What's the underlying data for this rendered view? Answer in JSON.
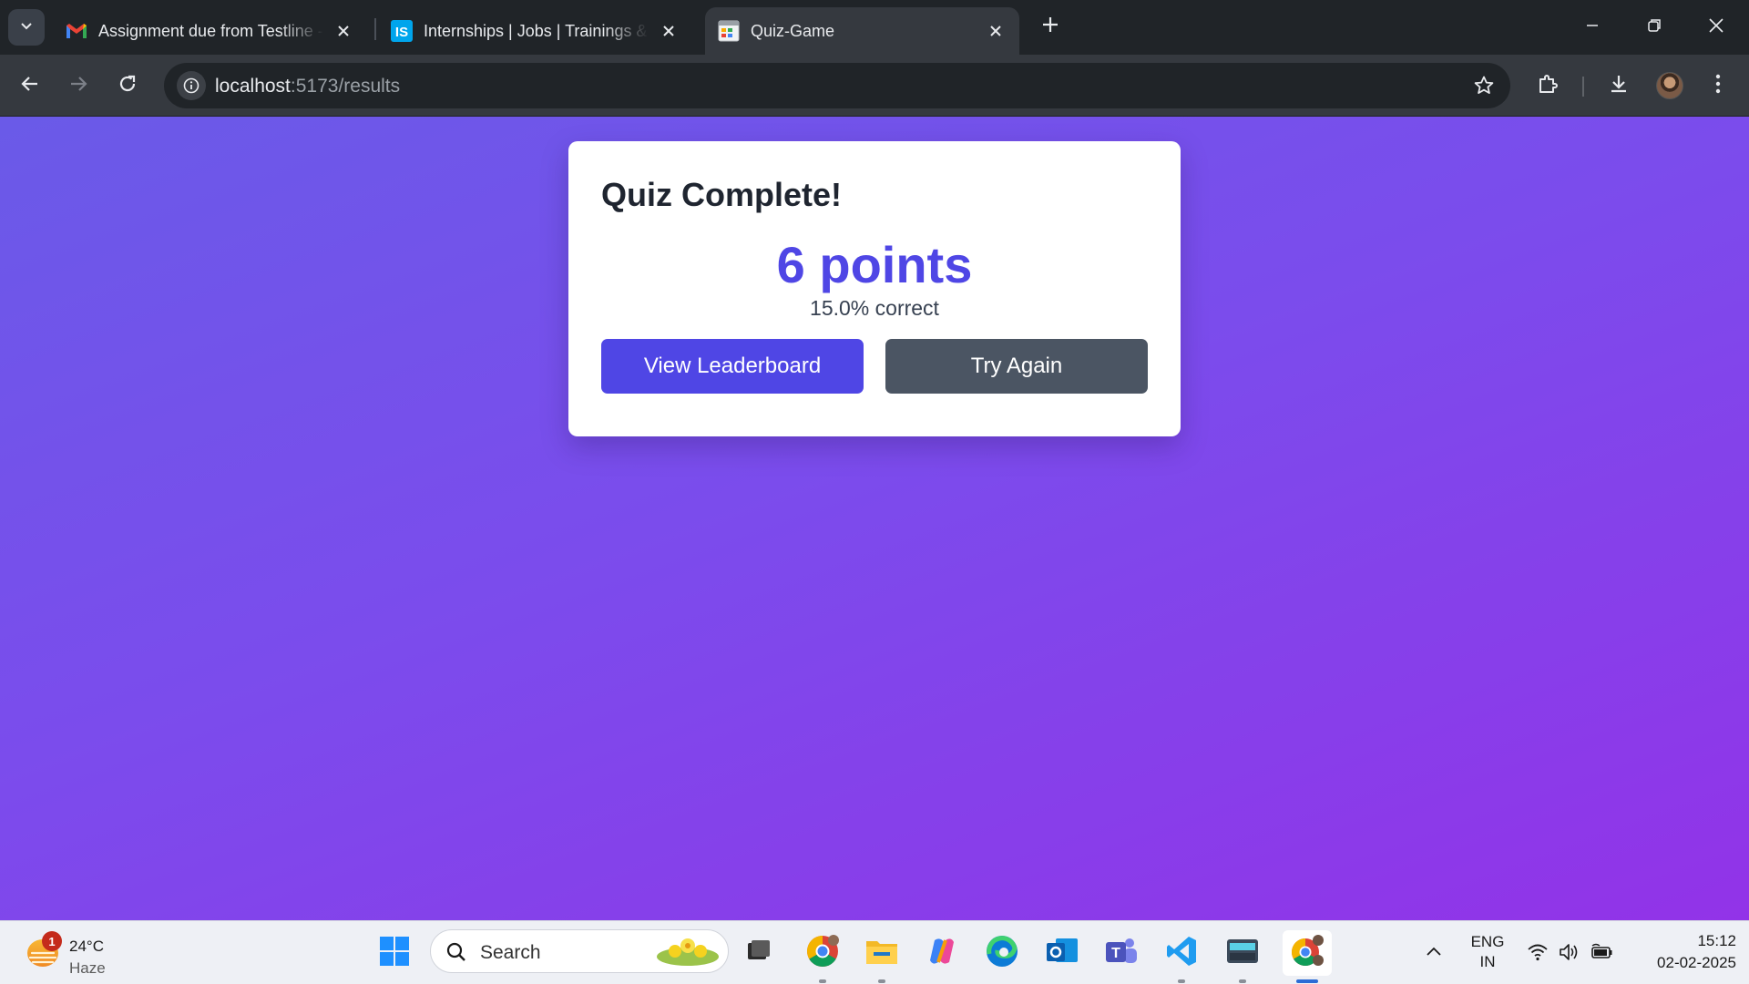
{
  "browser": {
    "tabs": [
      {
        "title": "Assignment due from Testline -",
        "favicon": "gmail-icon",
        "active": false
      },
      {
        "title": "Internships | Jobs | Trainings & I",
        "favicon": "internshala-icon",
        "active": false
      },
      {
        "title": "Quiz-Game",
        "favicon": "quiz-app-icon",
        "active": true
      }
    ],
    "address": {
      "host": "localhost",
      "path": ":5173/results"
    }
  },
  "results": {
    "heading": "Quiz Complete!",
    "score_text": "6 points",
    "percent_text": "15.0% correct",
    "leaderboard_label": "View Leaderboard",
    "retry_label": "Try Again"
  },
  "taskbar": {
    "weather": {
      "temp": "24°C",
      "condition": "Haze",
      "badge": "1"
    },
    "search_placeholder": "Search",
    "lang_line1": "ENG",
    "lang_line2": "IN",
    "time": "15:12",
    "date": "02-02-2025"
  },
  "colors": {
    "accent": "#4f46e5",
    "secondary_button": "#4b5563",
    "gradient_start": "#6a5ae8",
    "gradient_end": "#9233e8"
  }
}
